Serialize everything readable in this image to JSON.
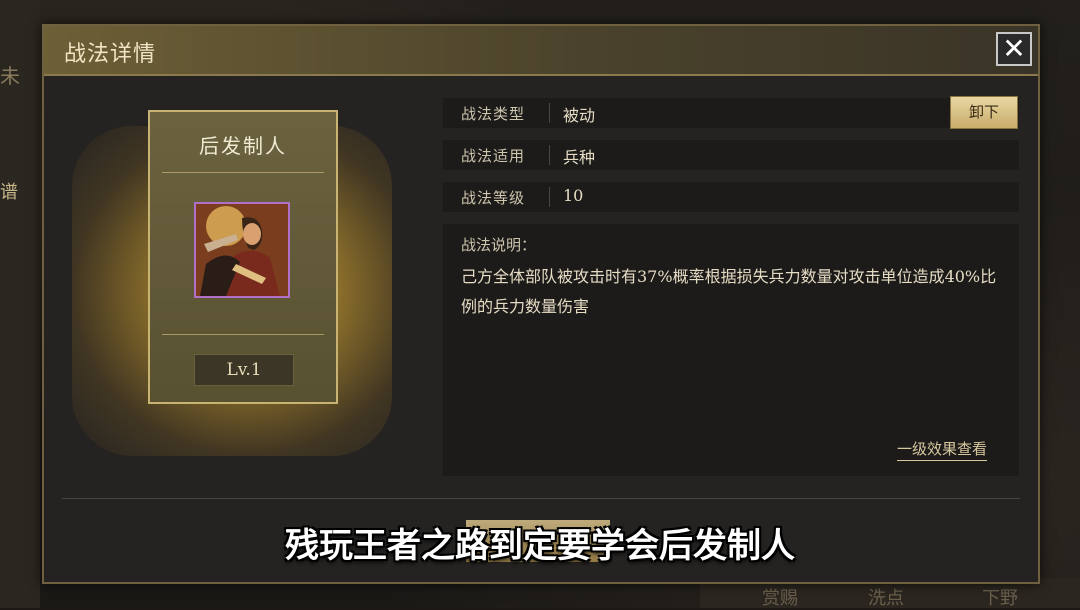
{
  "dialog": {
    "title": "战法详情",
    "close_label": "✕"
  },
  "card": {
    "skill_name": "后发制人",
    "level": "Lv.1"
  },
  "info": {
    "rows": [
      {
        "label": "战法类型",
        "value": "被动"
      },
      {
        "label": "战法适用",
        "value": "兵种"
      },
      {
        "label": "战法等级",
        "value": "10"
      }
    ],
    "unequip_label": "卸下"
  },
  "description": {
    "title": "战法说明：",
    "text": "己方全体部队被攻击时有37%概率根据损失兵力数量对攻击单位造成40%比例的兵力数量伤害",
    "effect_link": "一级效果查看"
  },
  "subtitle": {
    "text": "残玩王者之路到定要学会后发制人"
  },
  "background": {
    "left_text_top": "未",
    "left_text_mid": "谱",
    "bottom_buttons": [
      "赏赐",
      "洗点",
      "下野"
    ]
  },
  "colors": {
    "accent_gold": "#c9b372",
    "rarity_purple": "#b070c8"
  }
}
